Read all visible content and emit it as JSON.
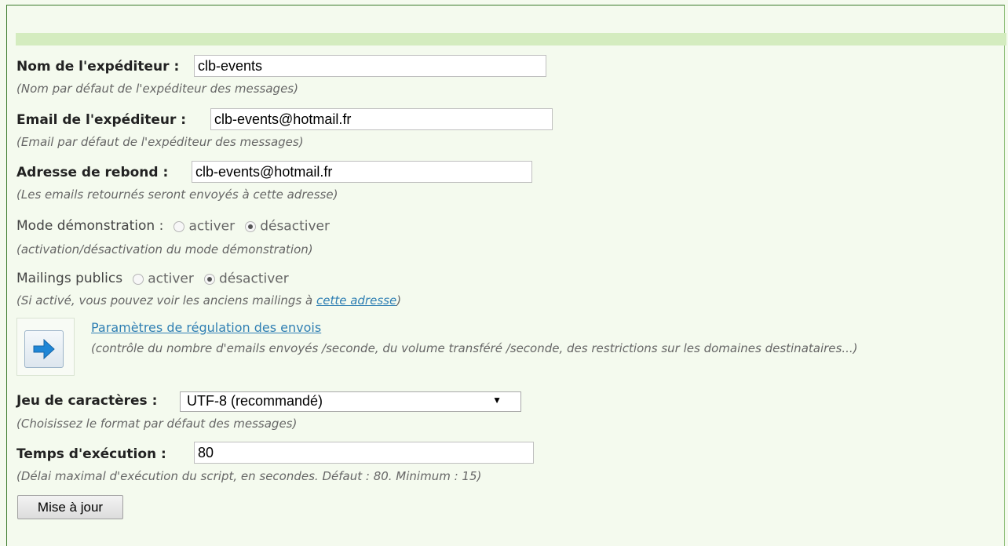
{
  "sender_name": {
    "label": "Nom de l'expéditeur :",
    "value": "clb-events",
    "hint": "(Nom par défaut de l'expéditeur des messages)"
  },
  "sender_email": {
    "label": "Email de l'expéditeur :",
    "value": "clb-events@hotmail.fr",
    "hint": "(Email par défaut de l'expéditeur des messages)"
  },
  "bounce_address": {
    "label": "Adresse de rebond :",
    "value": "clb-events@hotmail.fr",
    "hint": "(Les emails retournés seront envoyés à cette adresse)"
  },
  "demo_mode": {
    "label": "Mode démonstration :",
    "option_on": "activer",
    "option_off": "désactiver",
    "selected": "désactiver",
    "hint": "(activation/désactivation du mode démonstration)"
  },
  "public_mailings": {
    "label": "Mailings publics",
    "option_on": "activer",
    "option_off": "désactiver",
    "selected": "désactiver",
    "hint_prefix": "(Si activé, vous pouvez voir les anciens mailings à ",
    "hint_link": "cette adresse",
    "hint_suffix": ")"
  },
  "throttling": {
    "icon": "arrow-right-icon",
    "accent": "#1f86d6",
    "link": "Paramètres de régulation des envois",
    "description": "(contrôle du nombre d'emails envoyés /seconde, du volume transféré /seconde, des restrictions sur les domaines destinataires...)"
  },
  "charset": {
    "label": "Jeu de caractères :",
    "selected": "UTF-8 (recommandé)",
    "hint": "(Choisissez le format par défaut des messages)"
  },
  "execution_time": {
    "label": "Temps d'exécution :",
    "value": "80",
    "hint": "(Délai maximal d'exécution du script, en secondes. Défaut : 80. Minimum : 15)"
  },
  "submit": {
    "label": "Mise à jour"
  },
  "colors": {
    "background": "#f4faee",
    "header_bar": "#d4ecbf",
    "link": "#2f7fb3"
  }
}
